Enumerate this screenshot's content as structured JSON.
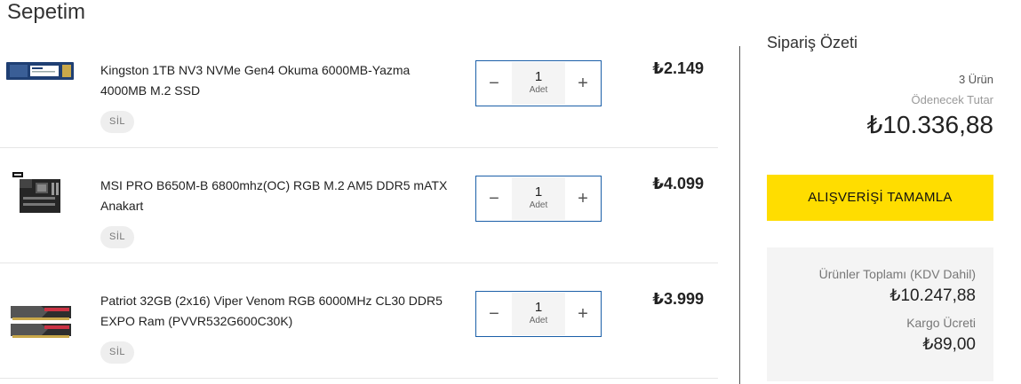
{
  "page_title": "Sepetim",
  "items": [
    {
      "name": "Kingston 1TB NV3 NVMe Gen4 Okuma 6000MB-Yazma 4000MB M.2 SSD",
      "quantity": "1",
      "unit": "Adet",
      "price": "₺2.149",
      "remove_label": "SİL"
    },
    {
      "name": "MSI PRO B650M-B 6800mhz(OC) RGB M.2 AM5 DDR5 mATX Anakart",
      "quantity": "1",
      "unit": "Adet",
      "price": "₺4.099",
      "remove_label": "SİL"
    },
    {
      "name": "Patriot 32GB (2x16) Viper Venom RGB 6000MHz CL30 DDR5 EXPO Ram (PVVR532G600C30K)",
      "quantity": "1",
      "unit": "Adet",
      "price": "₺3.999",
      "remove_label": "SİL"
    }
  ],
  "summary": {
    "title": "Sipariş Özeti",
    "item_count": "3 Ürün",
    "payable_label": "Ödenecek Tutar",
    "payable_total": "₺10.336,88",
    "checkout_label": "ALIŞVERİŞİ TAMAMLA",
    "products_total_label": "Ürünler Toplamı (KDV Dahil)",
    "products_total": "₺10.247,88",
    "shipping_label": "Kargo Ücreti",
    "shipping": "₺89,00"
  },
  "icons": {
    "decrease": "minus-icon",
    "increase": "plus-icon"
  },
  "colors": {
    "accent_button": "#ffdd00",
    "stepper_border": "#1b5fa8"
  }
}
